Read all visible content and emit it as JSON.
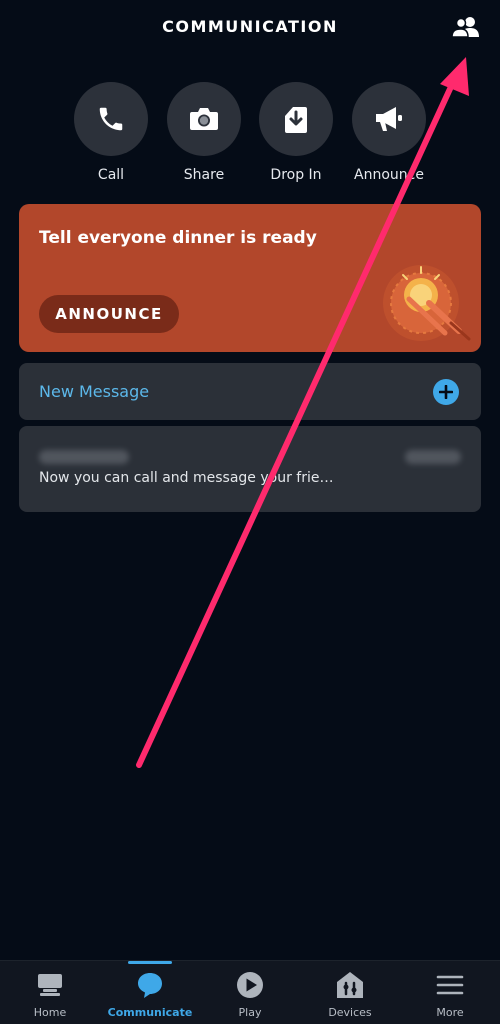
{
  "header": {
    "title": "COMMUNICATION",
    "contacts_icon": "contacts-icon"
  },
  "quick_actions": [
    {
      "label": "Call",
      "icon": "phone-icon"
    },
    {
      "label": "Share",
      "icon": "camera-icon"
    },
    {
      "label": "Drop In",
      "icon": "drop-in-icon"
    },
    {
      "label": "Announce",
      "icon": "megaphone-icon"
    }
  ],
  "announce_card": {
    "text": "Tell everyone dinner is ready",
    "button_label": "ANNOUNCE",
    "background_color": "#b2472b"
  },
  "new_message": {
    "label": "New Message",
    "icon": "plus-icon"
  },
  "conversation": {
    "preview": "Now you can call and message your frie…"
  },
  "tabs": [
    {
      "label": "Home",
      "icon": "home-icon",
      "active": false
    },
    {
      "label": "Communicate",
      "icon": "chat-bubble-icon",
      "active": true
    },
    {
      "label": "Play",
      "icon": "play-icon",
      "active": false
    },
    {
      "label": "Devices",
      "icon": "devices-icon",
      "active": false
    },
    {
      "label": "More",
      "icon": "menu-icon",
      "active": false
    }
  ],
  "colors": {
    "accent": "#3fa8e8",
    "link": "#5cb8ea",
    "annotation_arrow": "#ff2a6d"
  }
}
